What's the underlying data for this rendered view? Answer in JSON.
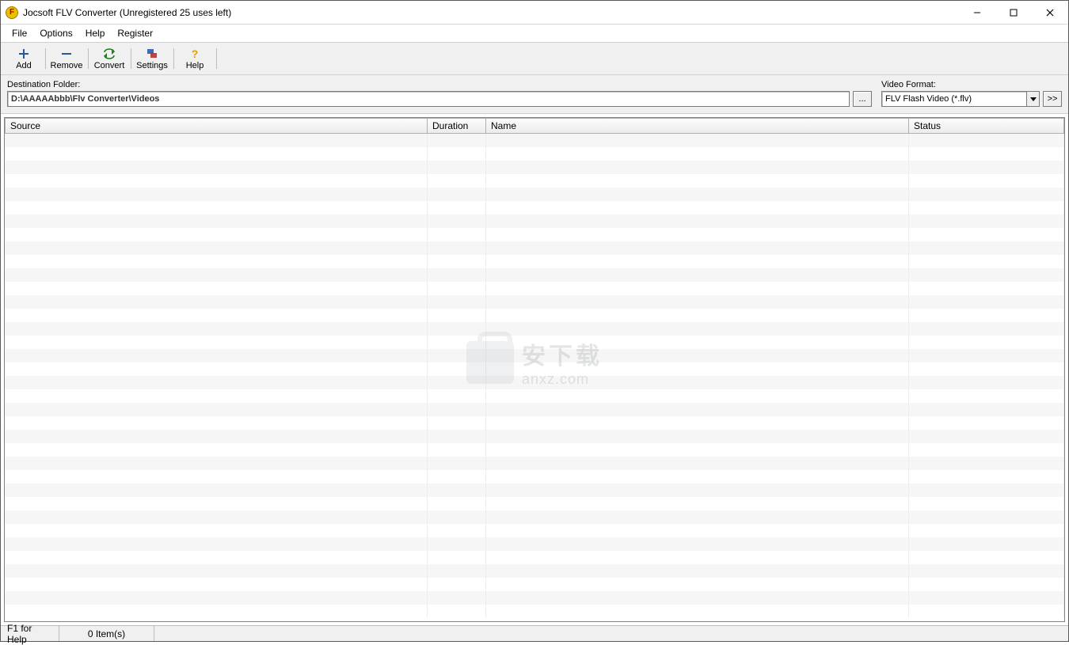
{
  "window": {
    "title": "Jocsoft FLV Converter (Unregistered 25 uses left)",
    "app_icon_letter": "F"
  },
  "menu": {
    "file": "File",
    "options": "Options",
    "help": "Help",
    "register": "Register"
  },
  "toolbar": {
    "add": "Add",
    "remove": "Remove",
    "convert": "Convert",
    "settings": "Settings",
    "help": "Help"
  },
  "destination": {
    "label": "Destination Folder:",
    "path": "D:\\AAAAAbbb\\Flv Converter\\Videos",
    "browse_label": "..."
  },
  "video_format": {
    "label": "Video Format:",
    "selected": "FLV Flash Video (*.flv)",
    "action_label": ">>"
  },
  "table": {
    "headers": {
      "source": "Source",
      "duration": "Duration",
      "name": "Name",
      "status": "Status"
    },
    "rows": []
  },
  "watermark": {
    "big": "安下载",
    "small": "anxz.com"
  },
  "status": {
    "help": "F1 for Help",
    "items": "0 Item(s)"
  }
}
